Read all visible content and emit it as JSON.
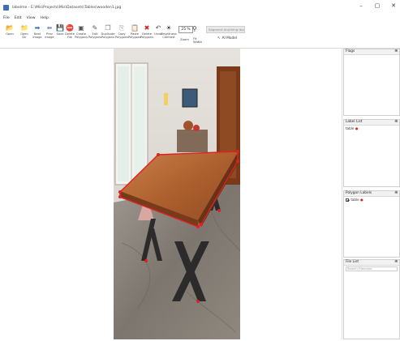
{
  "window": {
    "title": "labelme - E:\\Mis\\Projects\\Mis\\Datasets\\Tables\\wooden1.jpg",
    "controls": [
      "–",
      "▢",
      "✕"
    ]
  },
  "menu": [
    "File",
    "Edit",
    "View",
    "Help"
  ],
  "toolbar": {
    "tools": [
      {
        "name": "open",
        "label": "Open",
        "icon": "folder-icon",
        "glyph": "📂"
      },
      {
        "name": "open-dir",
        "label": "Open\nDir",
        "icon": "folder-open-icon",
        "glyph": "📁"
      },
      {
        "name": "next-image",
        "label": "Next\nImage",
        "icon": "arrow-right-icon",
        "glyph": "➡"
      },
      {
        "name": "prev-image",
        "label": "Prev\nImage",
        "icon": "arrow-left-icon",
        "glyph": "⬅"
      },
      {
        "name": "save",
        "label": "Save",
        "icon": "save-icon",
        "glyph": "💾"
      },
      {
        "name": "delete-file",
        "label": "Delete\nFile",
        "icon": "delete-file-icon",
        "glyph": "⛔"
      },
      {
        "name": "create-polygons",
        "label": "Create\nPolygons",
        "icon": "polygon-icon",
        "glyph": "▣"
      },
      {
        "name": "edit-polygons",
        "label": "Edit\nPolygons",
        "icon": "edit-icon",
        "glyph": "✎"
      },
      {
        "name": "duplicate-polygons",
        "label": "Duplicate\nPolygons",
        "icon": "copy-icon",
        "glyph": "❐"
      },
      {
        "name": "copy-polygons",
        "label": "Copy\nPolygons",
        "icon": "copy-polygons-icon",
        "glyph": "⎘"
      },
      {
        "name": "paste-polygons",
        "label": "Paste\nPolygons",
        "icon": "paste-icon",
        "glyph": "📋"
      },
      {
        "name": "delete-polygons",
        "label": "Delete\nPolygons",
        "icon": "delete-cross-icon",
        "glyph": "✖"
      },
      {
        "name": "undo",
        "label": "Undo",
        "icon": "undo-icon",
        "glyph": "↶"
      },
      {
        "name": "brightness-contrast",
        "label": "Brightness\nContrast",
        "icon": "brightness-icon",
        "glyph": "☀"
      }
    ],
    "zoom_value": "25 %",
    "zoom_label": "Zoom",
    "fit_label": "Fit\nWidth",
    "segment_placeholder": "Segment Anything (balanced)",
    "model_label": "AI Model"
  },
  "panels": {
    "flags": {
      "title": "Flags"
    },
    "label_list": {
      "title": "Label List",
      "items": [
        "table"
      ]
    },
    "polygon_labels": {
      "title": "Polygon Labels",
      "items": [
        "table"
      ]
    },
    "file_list": {
      "title": "File List",
      "search_placeholder": "Search Filename"
    }
  },
  "colors": {
    "polygon_edge": "#e02020",
    "label_swatch": "#e02020",
    "accent": "#3b6fb6"
  }
}
